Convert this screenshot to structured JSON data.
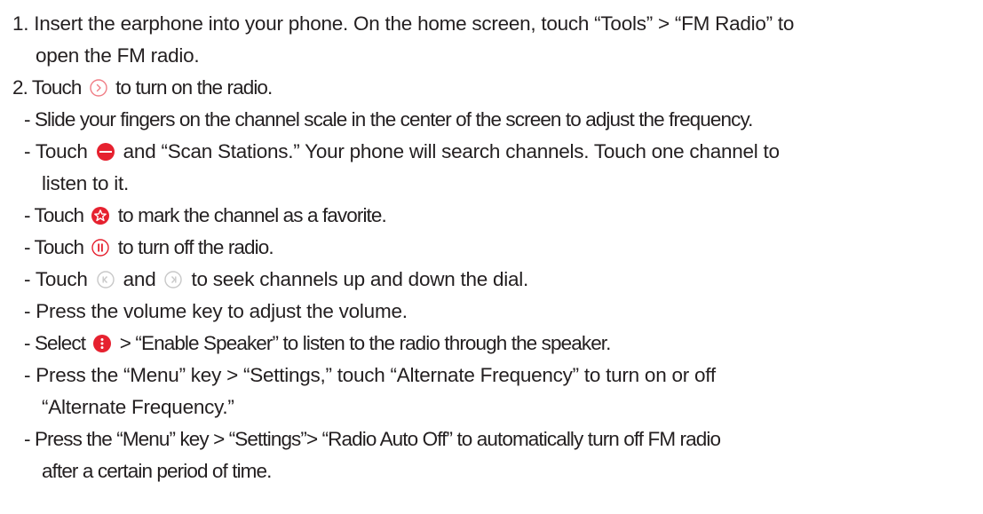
{
  "instructions": {
    "step1": {
      "line1": "1. Insert the earphone into your phone. On the home screen, touch “Tools” > “FM Radio” to",
      "line2": "open the FM radio."
    },
    "step2": {
      "before_icon": "2. Touch",
      "after_icon": "to turn on the radio."
    },
    "bullets": {
      "slide": "- Slide your fingers on the channel scale in the center of the screen to adjust the frequency.",
      "scan_before": "- Touch",
      "scan_after": "and “Scan Stations.” Your phone will search channels. Touch one channel to",
      "scan_cont": "listen to it.",
      "favorite_before": "- Touch",
      "favorite_after": "to mark the channel as a favorite.",
      "off_before": "- Touch",
      "off_after": "to turn off the radio.",
      "seek_before": "- Touch",
      "seek_mid": "and",
      "seek_after": "to seek channels up and down the dial.",
      "volume": "- Press the volume key to adjust the volume.",
      "speaker_before": "- Select",
      "speaker_after": "> “Enable Speaker” to listen to the radio through the speaker.",
      "af_line1": "- Press the “Menu” key > “Settings,” touch “Alternate Frequency” to turn on or off",
      "af_line2": "“Alternate Frequency.”",
      "auto_line1": "- Press the “Menu” key > “Settings”> “Radio Auto Off” to automatically turn off FM radio",
      "auto_line2": "after a certain period of time."
    }
  },
  "icons": {
    "power": "power-on-icon",
    "menu": "menu-icon",
    "favorite": "favorite-icon",
    "pause": "pause-icon",
    "prev": "seek-previous-icon",
    "next": "seek-next-icon",
    "more": "more-options-icon"
  },
  "colors": {
    "text": "#231f20",
    "accent_red": "#e6212f",
    "light_red": "#f07e86",
    "outline_gray": "#c8c8c8"
  }
}
